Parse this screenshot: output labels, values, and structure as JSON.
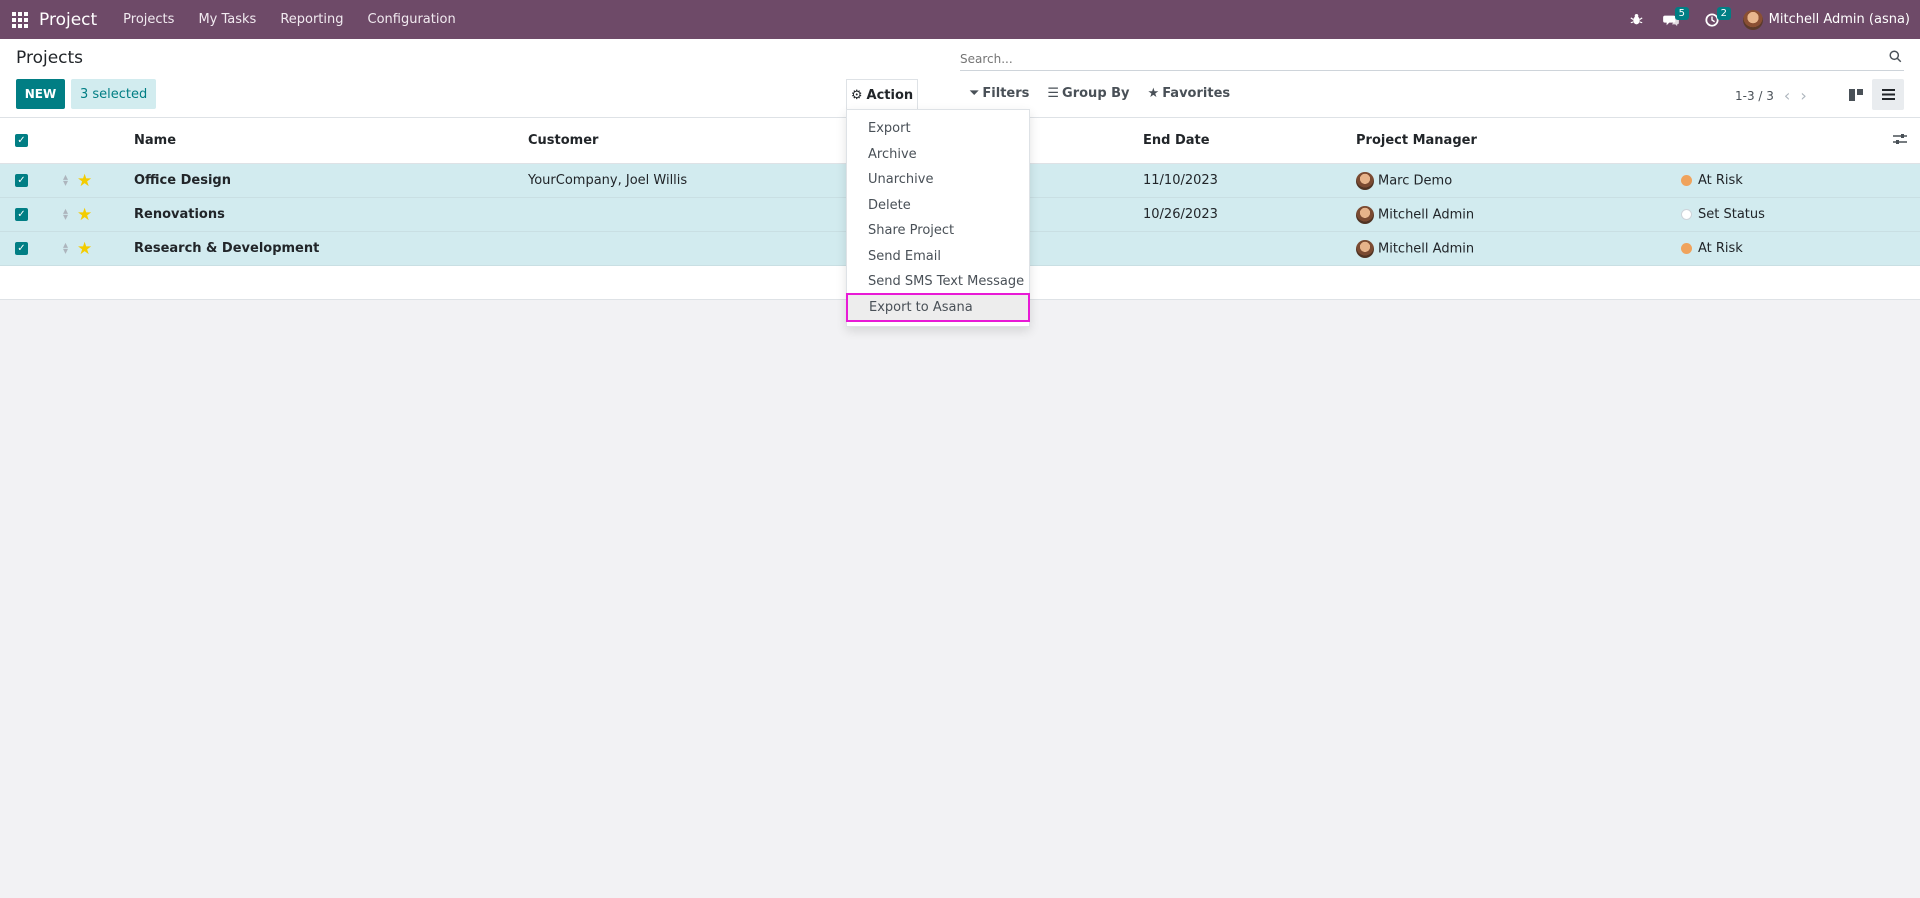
{
  "navbar": {
    "brand": "Project",
    "menu": [
      "Projects",
      "My Tasks",
      "Reporting",
      "Configuration"
    ],
    "messages_count": "5",
    "activities_count": "2",
    "user_name": "Mitchell Admin (asna)"
  },
  "control": {
    "title": "Projects",
    "new_label": "NEW",
    "selected_label": "3 selected",
    "action_label": "Action",
    "search_placeholder": "Search...",
    "filters_label": "Filters",
    "groupby_label": "Group By",
    "favorites_label": "Favorites",
    "pager": "1-3 / 3"
  },
  "table": {
    "headers": {
      "name": "Name",
      "customer": "Customer",
      "end_date": "End Date",
      "manager": "Project Manager"
    },
    "rows": [
      {
        "name": "Office Design",
        "customer": "YourCompany, Joel Willis",
        "end_date": "11/10/2023",
        "manager": "Marc Demo",
        "status": "At Risk"
      },
      {
        "name": "Renovations",
        "customer": "",
        "end_date": "10/26/2023",
        "manager": "Mitchell Admin",
        "status": "Set Status"
      },
      {
        "name": "Research & Development",
        "customer": "",
        "end_date": "",
        "manager": "Mitchell Admin",
        "status": "At Risk"
      }
    ]
  },
  "action_menu": {
    "items": [
      "Export",
      "Archive",
      "Unarchive",
      "Delete",
      "Share Project",
      "Send Email",
      "Send SMS Text Message",
      "Export to Asana"
    ]
  },
  "colors": {
    "navbar": "#6e4a68",
    "accent": "#017e84",
    "selected_row": "#d2ebef",
    "highlight_outline": "#e81ad6"
  }
}
